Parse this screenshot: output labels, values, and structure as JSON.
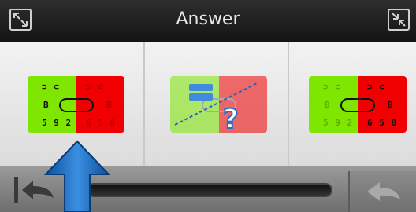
{
  "window": {
    "title": "Answer"
  },
  "options": [
    {
      "name": "option-left-match",
      "symbols_left": [
        "⊃ ⊂",
        "Β",
        "5 9 2"
      ],
      "symbols_right": [
        "⊃ ⊂",
        "Β",
        "6 5 8"
      ]
    },
    {
      "name": "option-unknown",
      "question_mark": "?"
    },
    {
      "name": "option-right-match",
      "symbols_left": [
        "⊃ ⊂",
        "Β",
        "5 9 2"
      ],
      "symbols_right": [
        "⊃ ⊂",
        "Β",
        "6 5 8"
      ]
    }
  ],
  "colors": {
    "green": "#7ee600",
    "red": "#f00000",
    "highlight_blue": "#1a73c9"
  },
  "icons": {
    "top_left": "expand-icon",
    "top_right": "collapse-icon",
    "undo": "undo-to-start-icon",
    "redo": "redo-icon",
    "pointer": "up-arrow-pointer-icon"
  }
}
